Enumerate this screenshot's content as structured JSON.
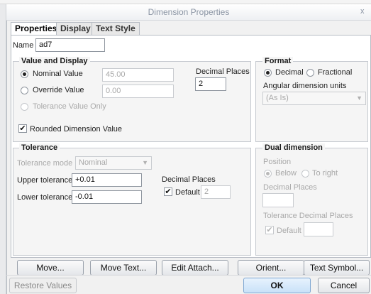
{
  "window": {
    "title": "Dimension Properties",
    "close": "x"
  },
  "tabs": [
    {
      "label": "Properties"
    },
    {
      "label": "Display"
    },
    {
      "label": "Text Style"
    }
  ],
  "name": {
    "label": "Name",
    "value": "ad7"
  },
  "value_display": {
    "title": "Value and Display",
    "nominal_label": "Nominal Value",
    "nominal_value": "45.00",
    "override_label": "Override Value",
    "override_value": "0.00",
    "tolerance_only_label": "Tolerance Value Only",
    "decimal_places_label": "Decimal Places",
    "decimal_places_value": "2",
    "rounded_label": "Rounded Dimension Value",
    "selected": "nominal",
    "rounded_checked": true
  },
  "format": {
    "title": "Format",
    "decimal_label": "Decimal",
    "fractional_label": "Fractional",
    "angular_label": "Angular dimension units",
    "angular_value": "(As Is)",
    "selected": "decimal"
  },
  "tolerance": {
    "title": "Tolerance",
    "mode_label": "Tolerance mode",
    "mode_value": "Nominal",
    "upper_label": "Upper tolerance",
    "upper_value": "+0.01",
    "lower_label": "Lower tolerance",
    "lower_value": "-0.01",
    "decimal_places_label": "Decimal Places",
    "default_label": "Default",
    "default_value": "2",
    "default_checked": true
  },
  "dual": {
    "title": "Dual dimension",
    "position_label": "Position",
    "below_label": "Below",
    "to_right_label": "To right",
    "decimal_places_label": "Decimal Places",
    "decimal_places_value": "",
    "tol_decimal_label": "Tolerance Decimal Places",
    "default_label": "Default",
    "default_value": "",
    "selected": "below"
  },
  "action_buttons": {
    "move": "Move...",
    "move_text": "Move Text...",
    "edit_attach": "Edit Attach...",
    "orient": "Orient...",
    "text_symbol": "Text Symbol..."
  },
  "footer": {
    "restore": "Restore Values",
    "ok": "OK",
    "cancel": "Cancel"
  },
  "colors": {
    "accent": "#c9e1f8",
    "border": "#b7bcc4",
    "disabled_text": "#a9a9a9"
  }
}
